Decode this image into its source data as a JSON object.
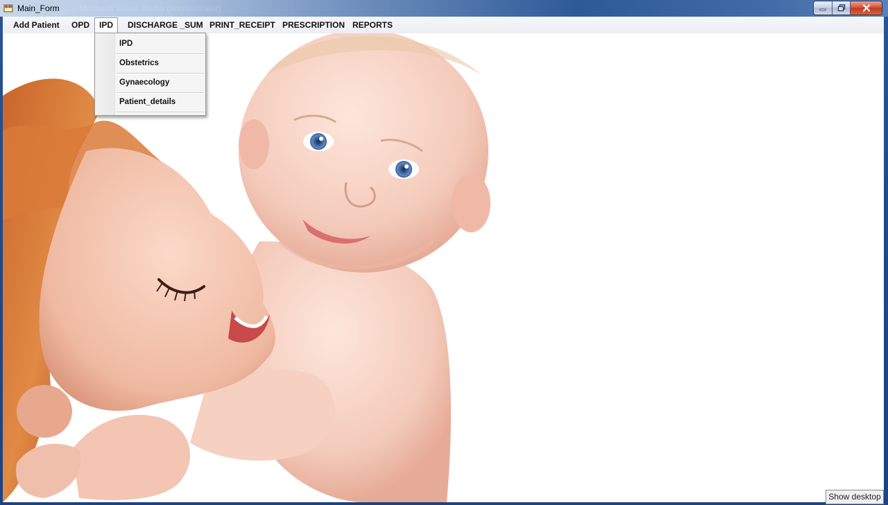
{
  "window": {
    "title": "Main_Form",
    "title_ghost": "… - Microsoft Visual Studio (Administrator)"
  },
  "menubar": {
    "items": [
      {
        "label": "Add Patient"
      },
      {
        "label": "OPD"
      },
      {
        "label": "IPD"
      },
      {
        "label": "DISCHARGE _SUM"
      },
      {
        "label": "PRINT_RECEIPT"
      },
      {
        "label": "PRESCRIPTION"
      },
      {
        "label": "REPORTS"
      }
    ],
    "open_menu": "IPD"
  },
  "ipd_menu": {
    "items": [
      {
        "label": "IPD"
      },
      {
        "label": "Obstetrics"
      },
      {
        "label": "Gynaecology"
      },
      {
        "label": "Patient_details"
      }
    ]
  },
  "tooltip": {
    "label": "Show desktop"
  },
  "colors": {
    "window_frame": "#1f4a8c",
    "close_button": "#c1391d",
    "menubar": "#eceef3",
    "background": "#ffffff"
  }
}
